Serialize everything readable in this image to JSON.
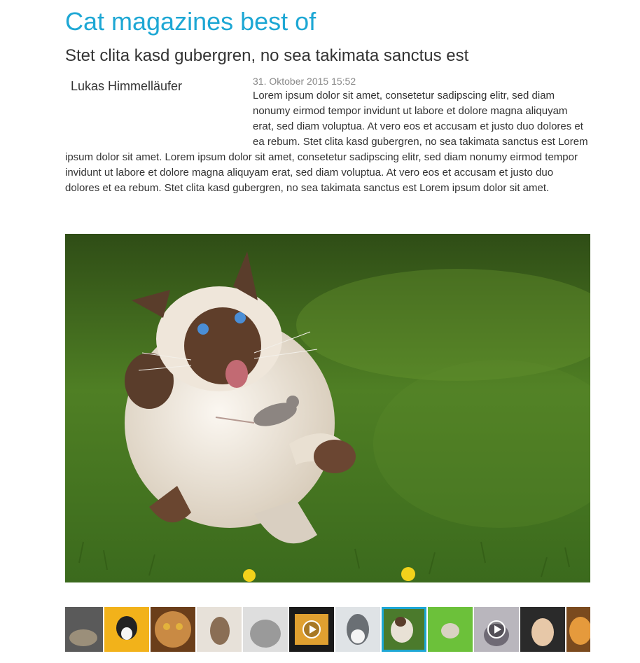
{
  "theme": {
    "accent": "#1da7d4",
    "text": "#333333",
    "muted": "#888888",
    "thumb_active_border": "#1da7d4"
  },
  "article": {
    "title": "Cat magazines best of",
    "subtitle": "Stet clita kasd gubergren, no sea takimata sanctus est",
    "author": "Lukas Himmelläufer",
    "date": "31. Oktober 2015 15:52",
    "body": "Lorem ipsum dolor sit amet, consetetur sadipscing elitr, sed diam nonumy eirmod tempor invidunt ut labore et dolore magna aliquyam erat, sed diam voluptua. At vero eos et accusam et justo duo dolores et ea rebum. Stet clita kasd gubergren, no sea takimata sanctus est Lorem ipsum dolor sit amet. Lorem ipsum dolor sit amet, consetetur sadipscing elitr, sed diam nonumy eirmod tempor invidunt ut labore et dolore magna aliquyam erat, sed diam voluptua. At vero eos et accusam et justo duo dolores et ea rebum. Stet clita kasd gubergren, no sea takimata sanctus est Lorem ipsum dolor sit amet."
  },
  "gallery": {
    "main_image": "siamese cat catching a mouse on grass",
    "thumbnails": [
      {
        "subject": "cats lying on floor",
        "video": false,
        "active": false,
        "colors": [
          "#5a5a5a",
          "#9b8f7a"
        ]
      },
      {
        "subject": "black and white kitten on yellow background",
        "video": false,
        "active": false,
        "colors": [
          "#f2b21a",
          "#222222"
        ]
      },
      {
        "subject": "orange cat face",
        "video": false,
        "active": false,
        "colors": [
          "#c98a44",
          "#6b3e1a"
        ]
      },
      {
        "subject": "tabby kitten standing",
        "video": false,
        "active": false,
        "colors": [
          "#e7e1d9",
          "#8a6e55"
        ]
      },
      {
        "subject": "grey fluffy kitten",
        "video": false,
        "active": false,
        "colors": [
          "#dedede",
          "#9a9a9a"
        ]
      },
      {
        "subject": "video of a cat",
        "video": true,
        "active": false,
        "colors": [
          "#1a1a1a",
          "#e0a030"
        ]
      },
      {
        "subject": "tabby white kitten",
        "video": false,
        "active": false,
        "colors": [
          "#dfe3e6",
          "#6a6f74"
        ]
      },
      {
        "subject": "siamese cat with mouse",
        "video": false,
        "active": true,
        "colors": [
          "#4b7a2c",
          "#e8e1d5"
        ]
      },
      {
        "subject": "kitten running on grass",
        "video": false,
        "active": false,
        "colors": [
          "#6cc13a",
          "#d9d2c2"
        ]
      },
      {
        "subject": "video of a kitten",
        "video": true,
        "active": false,
        "colors": [
          "#b9b6bd",
          "#6f6a75"
        ]
      },
      {
        "subject": "kitten lying on its back",
        "video": false,
        "active": false,
        "colors": [
          "#2a2a2a",
          "#e7c8a8"
        ]
      },
      {
        "subject": "orange kittens",
        "video": false,
        "active": false,
        "colors": [
          "#e59a3c",
          "#7a4a1e"
        ]
      }
    ]
  }
}
